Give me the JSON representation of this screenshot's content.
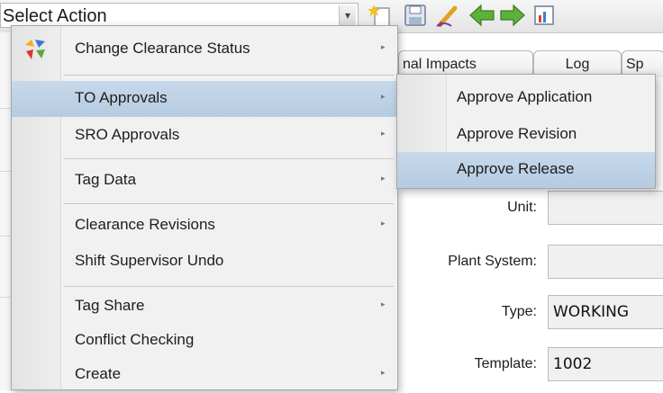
{
  "toolbar": {
    "select_label": "Select Action",
    "tools": [
      "new-icon",
      "save-icon",
      "edit-icon",
      "back-icon",
      "forward-icon",
      "report-icon"
    ]
  },
  "tabs": [
    "nal Impacts",
    "Log",
    "Sp"
  ],
  "form": {
    "unit_label": "Unit:",
    "unit_value": "",
    "plant_system_label": "Plant System:",
    "plant_system_value": "",
    "type_label": "Type:",
    "type_value": "WORKING",
    "template_label": "Template:",
    "template_value": "1002"
  },
  "menu": {
    "items": [
      {
        "label": "Change Clearance Status",
        "submenu": true,
        "active": false
      },
      {
        "label": "TO Approvals",
        "submenu": true,
        "active": true
      },
      {
        "label": "SRO Approvals",
        "submenu": true,
        "active": false
      },
      {
        "label": "Tag Data",
        "submenu": true,
        "active": false
      },
      {
        "label": "Clearance Revisions",
        "submenu": true,
        "active": false
      },
      {
        "label": "Shift Supervisor Undo",
        "submenu": false,
        "active": false
      },
      {
        "label": "Tag Share",
        "submenu": true,
        "active": false
      },
      {
        "label": "Conflict Checking",
        "submenu": false,
        "active": false
      },
      {
        "label": "Create",
        "submenu": true,
        "active": false
      }
    ],
    "arrow_glyph": "▸"
  },
  "submenu": {
    "items": [
      {
        "label": "Approve Application",
        "active": false
      },
      {
        "label": "Approve Revision",
        "active": false
      },
      {
        "label": "Approve Release",
        "active": true
      }
    ]
  },
  "colors": {
    "highlight": "#bcd0e5",
    "menu_bg": "#f1f1f1",
    "accent_green": "#5db13b"
  }
}
